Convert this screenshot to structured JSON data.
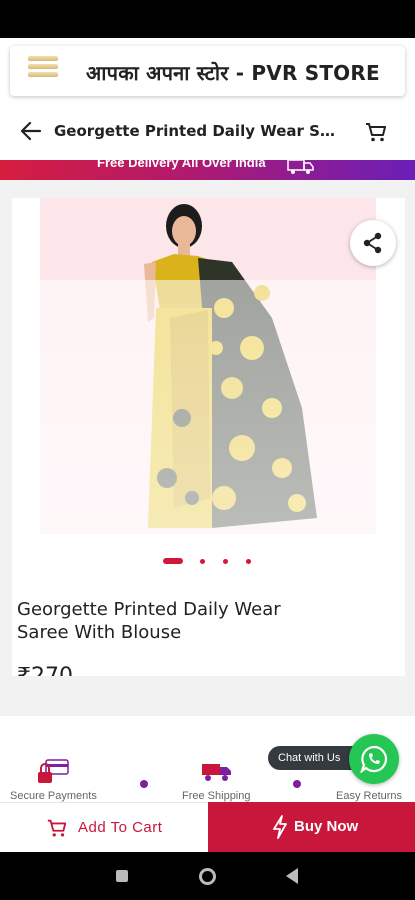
{
  "store": {
    "title": "आपका अपना स्टोर - PVR STORE"
  },
  "nav": {
    "title": "Georgette Printed Daily Wear Sare..."
  },
  "banner": {
    "text": "Free Delivery All Over India"
  },
  "product": {
    "name": "Georgette Printed Daily Wear Saree With Blouse",
    "price": "₹270",
    "slides": 4,
    "active_slide": 1
  },
  "features": [
    {
      "label": "Secure Payments",
      "icon": "card-lock-icon"
    },
    {
      "label": "Free Shipping",
      "icon": "truck-icon"
    },
    {
      "label": "Easy Returns",
      "icon": "return-icon"
    }
  ],
  "chat": {
    "label": "Chat with Us"
  },
  "actions": {
    "add_to_cart": "Add To Cart",
    "buy_now": "Buy Now"
  },
  "colors": {
    "accent": "#c8173b",
    "whatsapp": "#25c654",
    "feature_dot": "#7e1ea0"
  }
}
